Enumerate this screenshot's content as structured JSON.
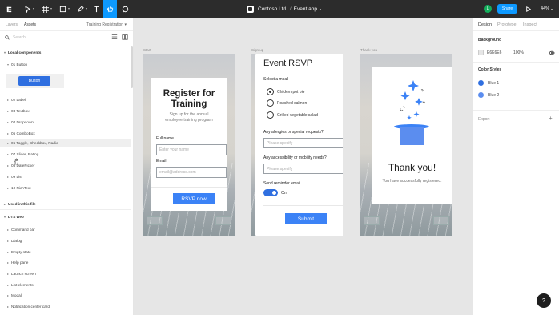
{
  "toolbar": {
    "doc_title": "Contoso Ltd.",
    "separator": "/",
    "file_name": "Event app",
    "user_initial": "L",
    "share_label": "Share",
    "zoom_level": "44%",
    "accent_color": "#0d99ff",
    "tools": [
      "menu-icon",
      "move-icon",
      "frame-icon",
      "shape-icon",
      "pen-icon",
      "text-icon",
      "hand-icon",
      "comment-icon"
    ]
  },
  "left_panel": {
    "tabs": [
      "Layers",
      "Assets"
    ],
    "page_selector": "Training Registration",
    "search_placeholder": "Search",
    "local_components": {
      "header": "Local components",
      "section": "01 Button",
      "preview_label": "Button",
      "items": [
        "02 Label",
        "03 Textbox",
        "04 Dropdown",
        "05 ComboBox",
        "06 Toggle, Checkbox, Radio",
        "07 Slider, Rating",
        "08 DatePicker",
        "09 List",
        "10 RichText"
      ]
    },
    "used_in_file": "Used in this file",
    "dts_web": {
      "header": "DTS web",
      "items": [
        "Command bar",
        "Dialog",
        "Empty state",
        "Help pane",
        "Launch screen",
        "List elements",
        "Modal",
        "Notification center card"
      ]
    }
  },
  "canvas": {
    "frame_labels": [
      "Start",
      "Sign up",
      "Thank you"
    ],
    "start": {
      "title": "Register for Training",
      "subtitle": "Sign up for the annual employee training program",
      "name_label": "Full name",
      "name_placeholder": "Enter your name",
      "email_label": "Email",
      "email_placeholder": "email@address.com",
      "button_label": "RSVP now"
    },
    "signup": {
      "title": "Event RSVP",
      "meal_label": "Select a meal",
      "meals": [
        "Chicken pot pie",
        "Poached salmon",
        "Grilled vegetable salad"
      ],
      "selected_meal": "Chicken pot pie",
      "allergies_label": "Any allergies or special requests?",
      "allergies_placeholder": "Please specify",
      "accessibility_label": "Any accessibility or mobility needs?",
      "accessibility_placeholder": "Please specify",
      "reminder_label": "Send reminder email",
      "toggle_label": "On",
      "submit_label": "Submit"
    },
    "thanks": {
      "title": "Thank you!",
      "subtitle": "You have successfully registered."
    }
  },
  "right_panel": {
    "tabs": [
      "Design",
      "Prototype",
      "Inspect"
    ],
    "background_header": "Background",
    "bg_hex": "E6E6E6",
    "bg_opacity": "100%",
    "color_styles_header": "Color Styles",
    "color_styles": [
      {
        "name": "Blue 1",
        "color": "#2f6fe0"
      },
      {
        "name": "Blue 2",
        "color": "#5b8def"
      }
    ],
    "export_label": "Export"
  },
  "help_label": "?"
}
